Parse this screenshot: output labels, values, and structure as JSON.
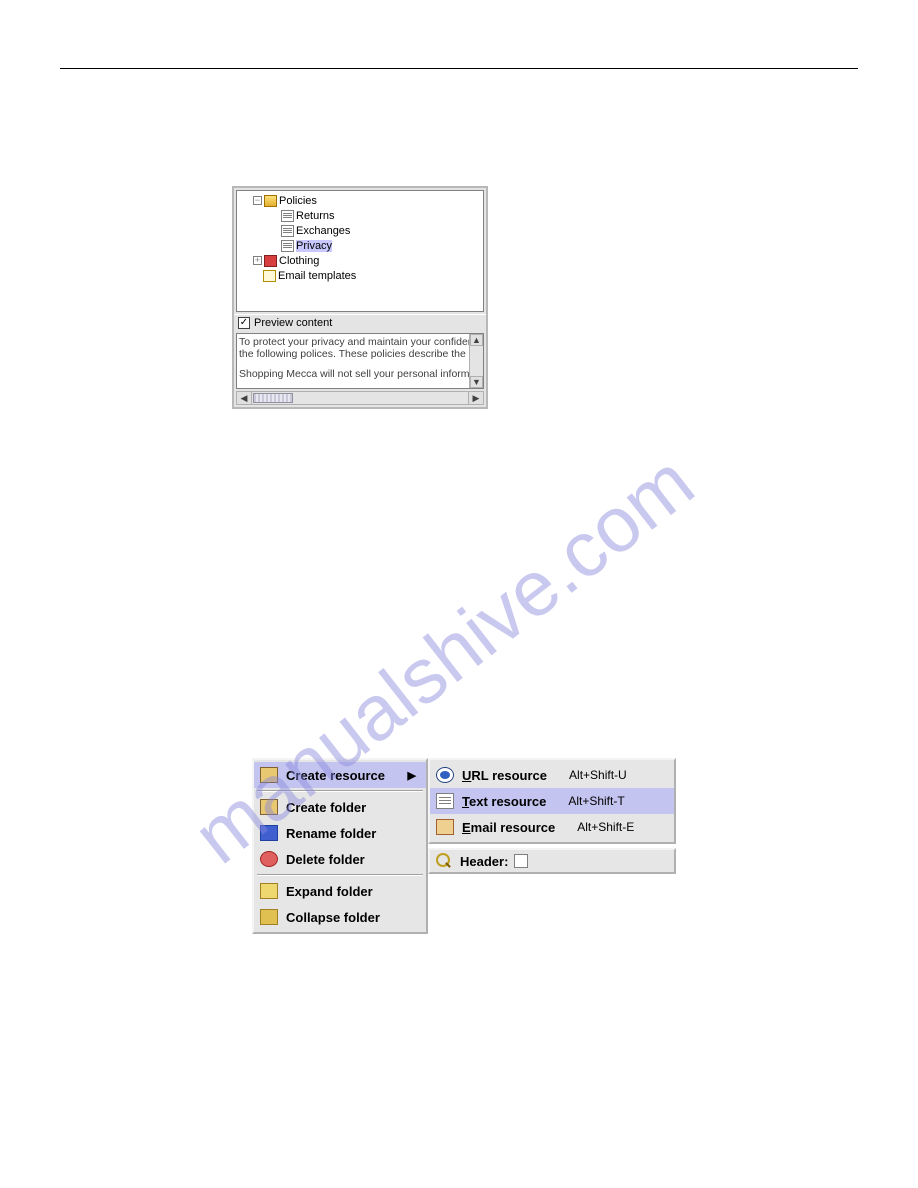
{
  "tree": {
    "policies": {
      "label": "Policies",
      "expanded": true
    },
    "returns": {
      "label": "Returns"
    },
    "exchanges": {
      "label": "Exchanges"
    },
    "privacy": {
      "label": "Privacy",
      "selected": true
    },
    "clothing": {
      "label": "Clothing",
      "expanded": false
    },
    "email_templates": {
      "label": "Email templates"
    }
  },
  "preview": {
    "checkbox_checked": "✓",
    "header": "Preview content",
    "line1": "To protect your privacy and maintain your confidenc",
    "line2": "the following polices. These policies describe the s",
    "line3": "Shopping Mecca will not sell your personal informat"
  },
  "context_menu": {
    "main": {
      "create_resource": "Create resource",
      "create_folder": "Create folder",
      "rename_folder": "Rename folder",
      "delete_folder": "Delete folder",
      "expand_folder": "Expand folder",
      "collapse_folder": "Collapse folder"
    },
    "sub": {
      "url_resource": {
        "label": "URL resource",
        "shortcut": "Alt+Shift-U"
      },
      "text_resource": {
        "label": "Text resource",
        "shortcut": "Alt+Shift-T"
      },
      "email_resource": {
        "label": "Email resource",
        "shortcut": "Alt+Shift-E"
      }
    }
  },
  "header_strip": {
    "label": "Header:"
  },
  "watermark": "manualshive.com"
}
